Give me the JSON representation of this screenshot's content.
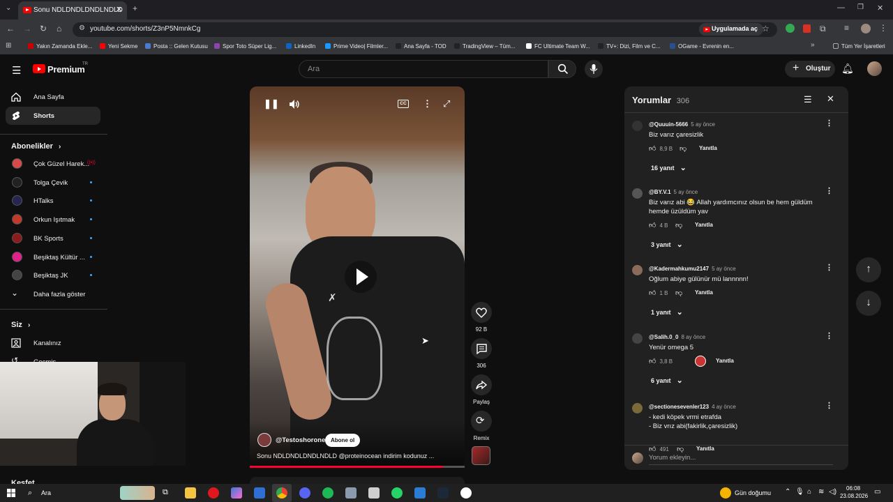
{
  "browser": {
    "tab_title": "Sonu NDLDNDLDNDLNDLD",
    "url": "youtube.com/shorts/Z3nP5NmnkCg",
    "open_in_app": "Uygulamada aç",
    "bookmarks": [
      {
        "label": "Yakın Zamanda Ekle...",
        "color": "#cc0000"
      },
      {
        "label": "Yeni Sekme",
        "color": "#ff0000"
      },
      {
        "label": "Posta :: Gelen Kutusu",
        "color": "#4a7bd1"
      },
      {
        "label": "Spor Toto Süper Lig...",
        "color": "#8e44ad"
      },
      {
        "label": "LinkedIn",
        "color": "#0a66c2"
      },
      {
        "label": "Prime Video| Filmler...",
        "color": "#1a98ff"
      },
      {
        "label": "Ana Sayfa - TOD",
        "color": "#222222"
      },
      {
        "label": "TradingView – Tüm...",
        "color": "#222222"
      },
      {
        "label": "FC Ultimate Team W...",
        "color": "#ffffff"
      },
      {
        "label": "TV+: Dizi, Film ve C...",
        "color": "#222222"
      },
      {
        "label": "OGame - Evrenin en...",
        "color": "#2b4f8e"
      }
    ],
    "all_bookmarks": "Tüm Yer İşaretleri"
  },
  "youtube": {
    "logo_text": "Premium",
    "logo_badge": "TR",
    "search_placeholder": "Ara",
    "create_label": "Oluştur"
  },
  "sidebar": {
    "main": [
      {
        "label": "Ana Sayfa",
        "icon": "home-icon"
      },
      {
        "label": "Shorts",
        "icon": "shorts-icon",
        "active": true
      }
    ],
    "subscriptions_title": "Abonelikler",
    "subscriptions": [
      {
        "label": "Çok Güzel Harek...",
        "color": "#d84a4a",
        "live": true
      },
      {
        "label": "Tolga Çevik",
        "color": "#222222"
      },
      {
        "label": "HTalks",
        "color": "#262650"
      },
      {
        "label": "Orkun Işıtmak",
        "color": "#c0392b"
      },
      {
        "label": "BK Sports",
        "color": "#8e1b1b"
      },
      {
        "label": "Beşiktaş Kültür ...",
        "color": "#e0218a"
      },
      {
        "label": "Beşiktaş JK",
        "color": "#444444"
      }
    ],
    "show_more": "Daha fazla göster",
    "you_title": "Siz",
    "you_items": [
      {
        "label": "Kanalınız"
      },
      {
        "label": "Geçmiş"
      }
    ],
    "bottom_title": "Keşfet"
  },
  "video": {
    "channel": "@Testoshorone",
    "subscribe": "Abone ol",
    "title": "Sonu NDLDNDLDNDLNDLD @proteinocean indirim kodunuz ...",
    "progress": 0.9,
    "actions": [
      {
        "label": "92 B",
        "icon": "like-icon"
      },
      {
        "label": "306",
        "icon": "comment-icon"
      },
      {
        "label": "Paylaş",
        "icon": "share-icon"
      },
      {
        "label": "Remix",
        "icon": "remix-icon"
      }
    ]
  },
  "comments": {
    "title": "Yorumlar",
    "count": "306",
    "reply_label": "Yanıtla",
    "add_placeholder": "Yorum ekleyin...",
    "items": [
      {
        "author": "@Quuuin-5666",
        "time": "5 ay önce",
        "text": "Biz varız çaresizlik",
        "likes": "8,9 B",
        "replies": "16 yanıt"
      },
      {
        "author": "@BY.V.1",
        "time": "5 ay önce",
        "text": "Biz varız abi 😂 Allah yardımcınız olsun be hem güldüm hemde üzüldüm yav",
        "likes": "4 B",
        "replies": "3 yanıt"
      },
      {
        "author": "@Kadermahkumu2147",
        "time": "5 ay önce",
        "text": "Oğlum abiye gülünür mü lannnnn!",
        "likes": "1 B",
        "replies": "1 yanıt"
      },
      {
        "author": "@Salih.0_0",
        "time": "8 ay önce",
        "text": "Yenür omega 5",
        "likes": "3,8 B",
        "replies": "6 yanıt"
      },
      {
        "author": "@sectionesevenler123",
        "time": "4 ay önce",
        "text": "- kedi köpek vrmi etrafda\n- Biz vrız abi(fakirlik,çaresizlik)",
        "likes": "491",
        "replies": ""
      }
    ]
  },
  "taskbar": {
    "search": "Ara",
    "weather": "Gün doğumu",
    "time": "06:08",
    "date": "23.08.2026"
  }
}
